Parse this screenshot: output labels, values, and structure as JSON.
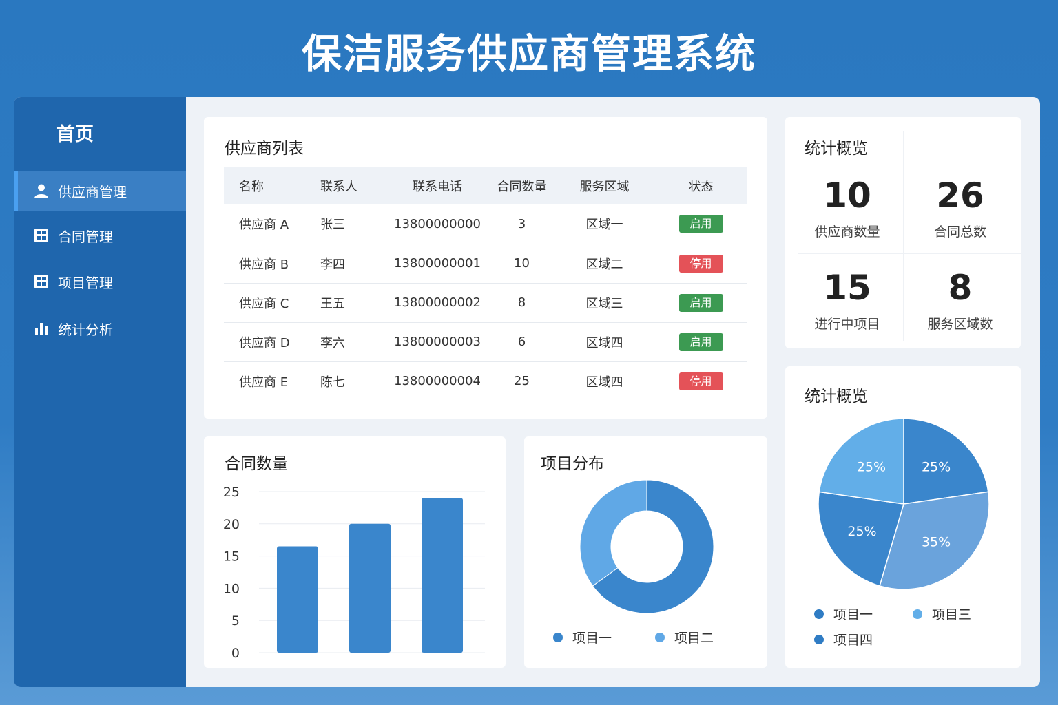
{
  "app_title": "保洁服务供应商管理系统",
  "sidebar": {
    "home": "首页",
    "items": [
      {
        "label": "供应商管理",
        "icon": "user-icon",
        "active": true
      },
      {
        "label": "合同管理",
        "icon": "grid-icon",
        "active": false
      },
      {
        "label": "项目管理",
        "icon": "grid-icon",
        "active": false
      },
      {
        "label": "统计分析",
        "icon": "bar-chart-icon",
        "active": false
      }
    ]
  },
  "supplier_table": {
    "title": "供应商列表",
    "columns": [
      "名称",
      "联系人",
      "联系电话",
      "合同数量",
      "服务区域",
      "状态"
    ],
    "rows": [
      {
        "name": "供应商 A",
        "contact": "张三",
        "phone": "13800000000",
        "contracts": "3",
        "area": "区域一",
        "status": "启用",
        "status_color": "#3c9a52"
      },
      {
        "name": "供应商 B",
        "contact": "李四",
        "phone": "13800000001",
        "contracts": "10",
        "area": "区域二",
        "status": "停用",
        "status_color": "#e45258"
      },
      {
        "name": "供应商 C",
        "contact": "王五",
        "phone": "13800000002",
        "contracts": "8",
        "area": "区域三",
        "status": "启用",
        "status_color": "#3c9a52"
      },
      {
        "name": "供应商 D",
        "contact": "李六",
        "phone": "13800000003",
        "contracts": "6",
        "area": "区域四",
        "status": "启用",
        "status_color": "#3c9a52"
      },
      {
        "name": "供应商 E",
        "contact": "陈七",
        "phone": "13800000004",
        "contracts": "25",
        "area": "区域四",
        "status": "停用",
        "status_color": "#e45258"
      }
    ]
  },
  "stats": {
    "title": "统计概览",
    "cells": [
      {
        "value": "10",
        "label": "供应商数量"
      },
      {
        "value": "26",
        "label": "合同总数"
      },
      {
        "value": "15",
        "label": "进行中项目"
      },
      {
        "value": "8",
        "label": "服务区域数"
      }
    ]
  },
  "bar_card": {
    "title": "合同数量",
    "chart_data": {
      "type": "bar",
      "values": [
        16.5,
        20,
        24
      ],
      "yticks": [
        "25",
        "20",
        "15",
        "10",
        "5",
        "0"
      ],
      "ylim": [
        0,
        25
      ],
      "bar_color": "#3a86cc"
    }
  },
  "donut_card": {
    "title": "项目分布",
    "chart_data": {
      "type": "pie",
      "slices": [
        {
          "name": "项目一",
          "value": 65,
          "color": "#3a86cc"
        },
        {
          "name": "项目二",
          "value": 35,
          "color": "#60a8e6"
        }
      ]
    },
    "legend": [
      {
        "label": "项目一",
        "color": "#3a86cc"
      },
      {
        "label": "项目二",
        "color": "#60a8e6"
      }
    ]
  },
  "pie_card": {
    "title": "统计概览",
    "chart_data": {
      "type": "pie",
      "slices": [
        {
          "label": "25%",
          "value": 25,
          "color": "#3a86cc"
        },
        {
          "label": "35%",
          "value": 35,
          "color": "#6aa3dc"
        },
        {
          "label": "25%",
          "value": 25,
          "color": "#3a86cc"
        },
        {
          "label": "25%",
          "value": 25,
          "color": "#62aee8"
        }
      ]
    },
    "legend": [
      {
        "label": "项目一",
        "color": "#2f7cc4"
      },
      {
        "label": "项目三",
        "color": "#62aee8"
      },
      {
        "label": "项目四",
        "color": "#2f7cc4"
      }
    ]
  }
}
